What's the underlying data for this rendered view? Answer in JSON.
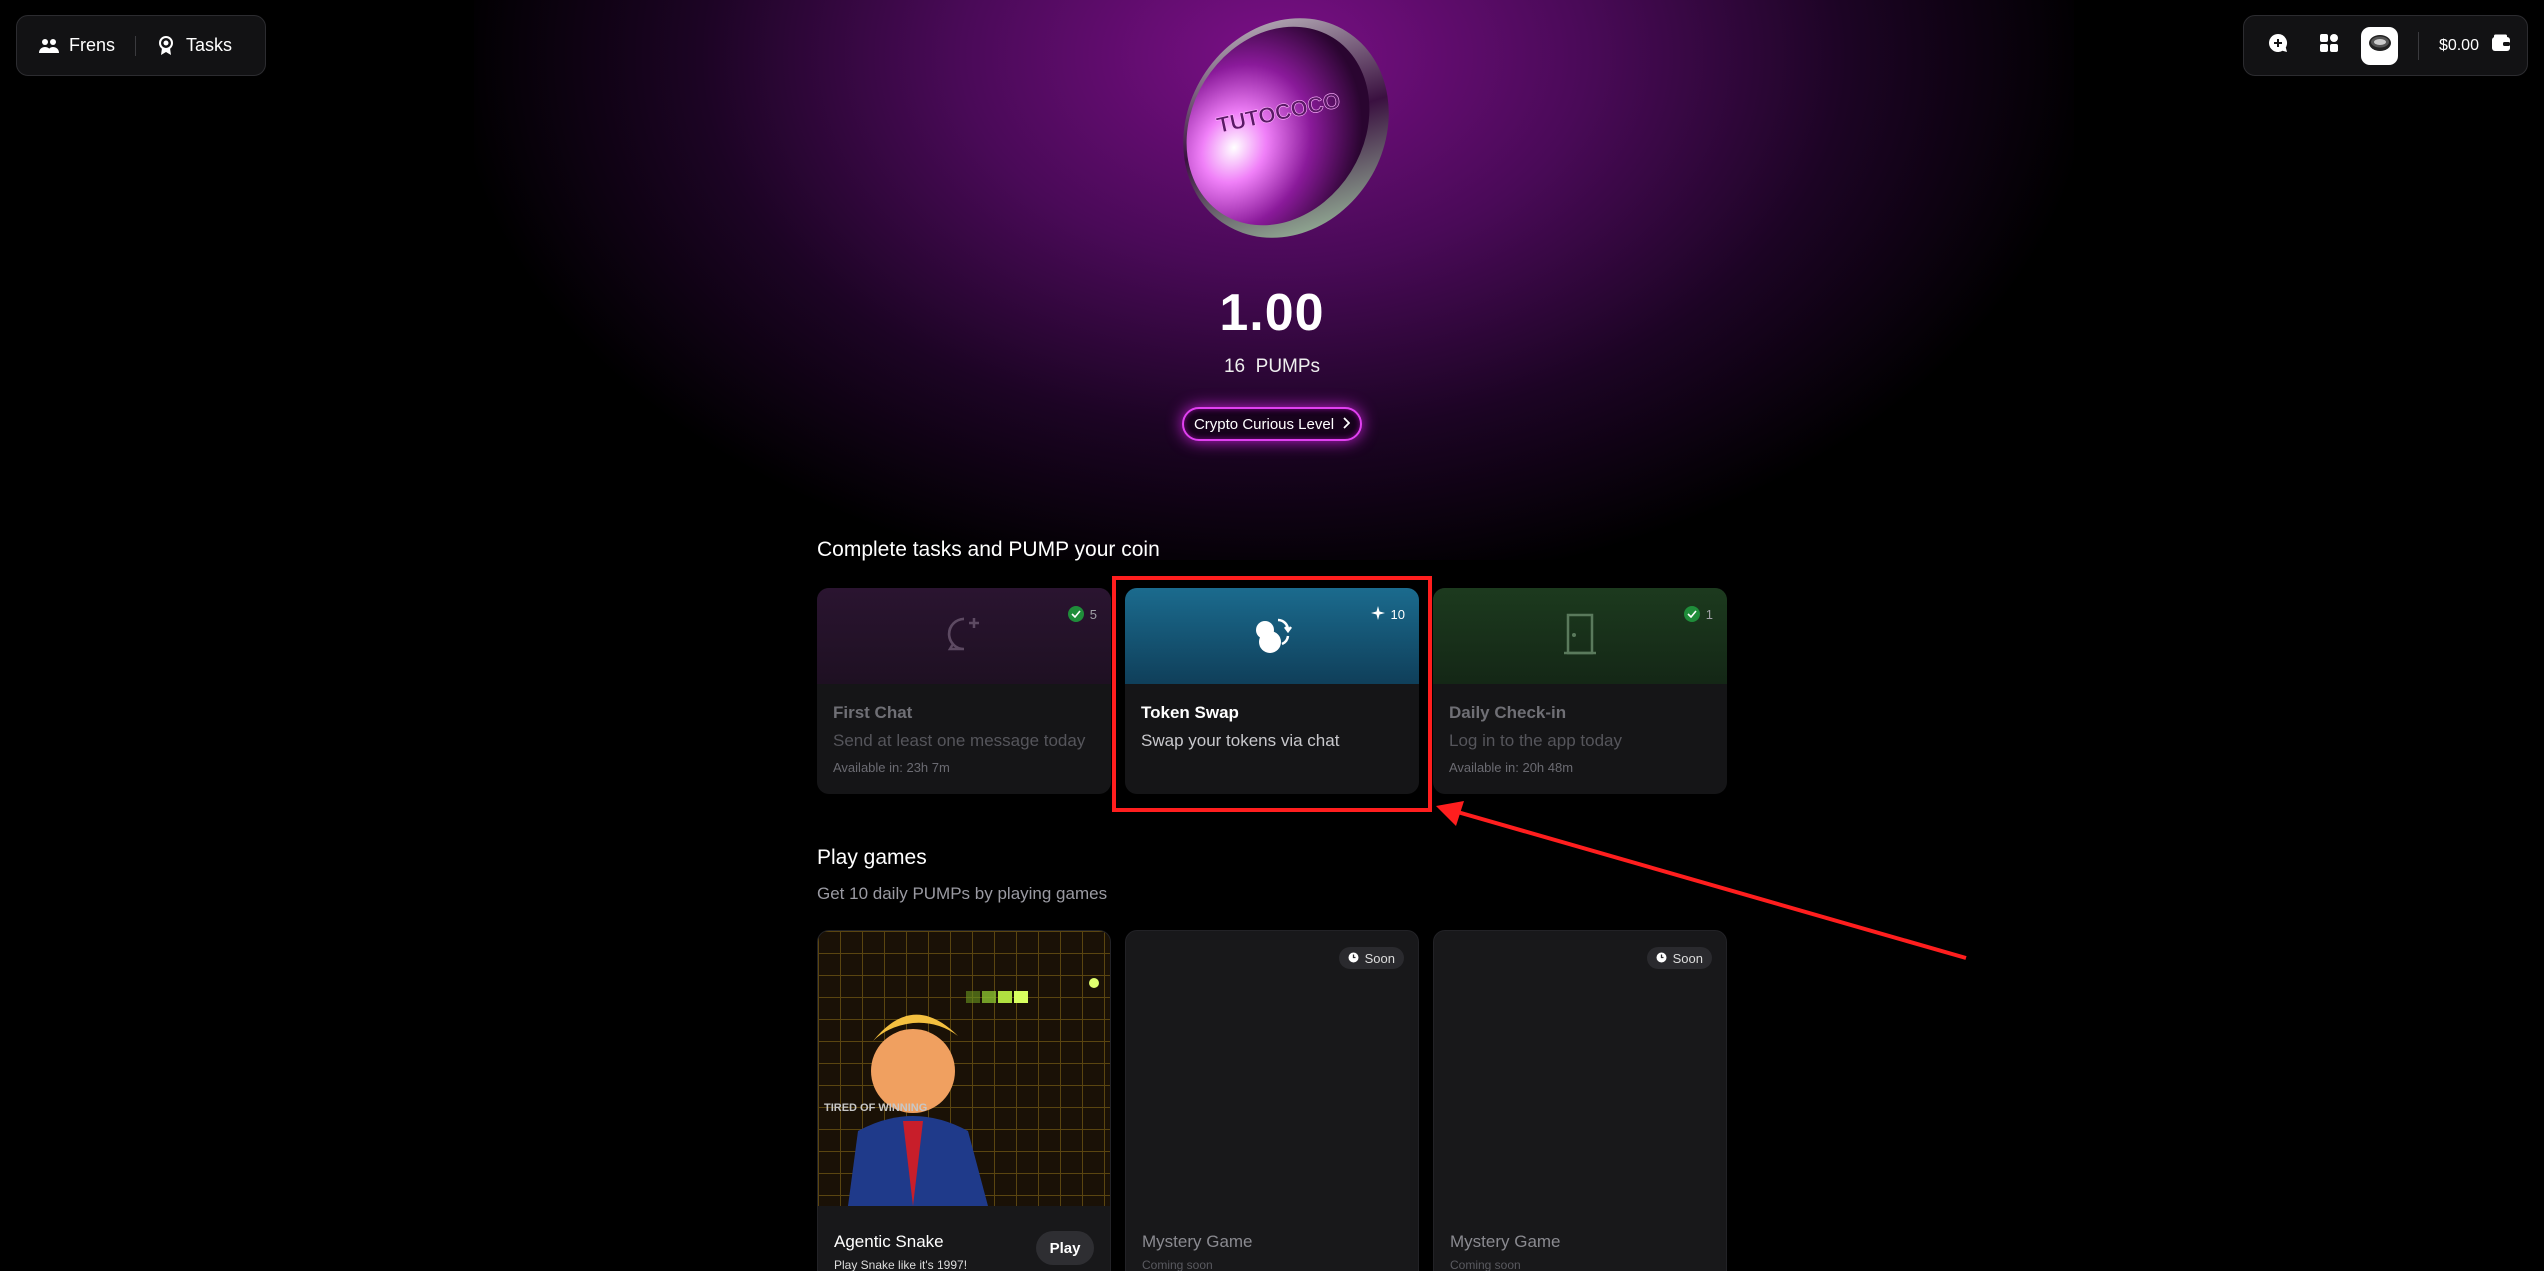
{
  "nav": {
    "frens_label": "Frens",
    "tasks_label": "Tasks"
  },
  "toolbar": {
    "balance_label": "$0.00"
  },
  "hero": {
    "coin_text": "TUTOCOCO",
    "balance": "1.00",
    "pumps_count": "16",
    "pumps_unit": "PUMPs",
    "level_label": "Crypto Curious Level"
  },
  "tasks_section": {
    "title": "Complete tasks and PUMP your coin",
    "cards": [
      {
        "name": "First Chat",
        "description": "Send at least one message today",
        "available": "Available in: 23h 7m",
        "badge": "5",
        "icon": "chat-plus-icon",
        "done": true
      },
      {
        "name": "Token Swap",
        "description": "Swap your tokens via chat",
        "available": "",
        "badge": "10",
        "icon": "token-swap-icon",
        "done": false
      },
      {
        "name": "Daily Check-in",
        "description": "Log in to the app today",
        "available": "Available in: 20h 48m",
        "badge": "1",
        "icon": "door-icon",
        "done": true
      }
    ]
  },
  "games_section": {
    "title": "Play games",
    "subtitle": "Get 10 daily PUMPs by playing games",
    "cards": [
      {
        "name": "Agentic Snake",
        "subtitle": "Play Snake like it's 1997!",
        "action": "Play",
        "art_text": "TIRED OF WINNING"
      },
      {
        "name": "Mystery Game",
        "subtitle": "Coming soon",
        "badge": "Soon"
      },
      {
        "name": "Mystery Game",
        "subtitle": "Coming soon",
        "badge": "Soon"
      }
    ]
  },
  "colors": {
    "accent": "#e040f0",
    "highlight": "#ff1e1e",
    "success": "#1f8d3a"
  }
}
